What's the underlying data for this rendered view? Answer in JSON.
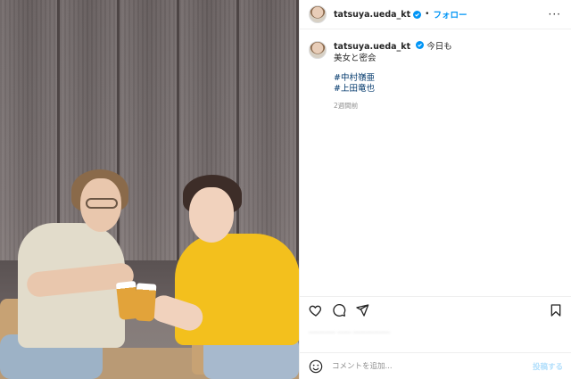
{
  "post": {
    "username": "tatsuya.ueda_kt",
    "follow_label": "フォロー",
    "caption_lines": [
      "今日も",
      "美女と密会"
    ],
    "hashtags": [
      "#中村嶺亜",
      "#上田竜也"
    ],
    "time_ago": "2週間前",
    "likes_text": "________ ____ ___________",
    "comment_placeholder": "コメントを追加...",
    "post_label": "投稿する"
  },
  "icons": {
    "more": "more-icon",
    "verified": "verified-badge-icon",
    "like": "heart-icon",
    "comment": "comment-icon",
    "share": "share-icon",
    "save": "bookmark-icon",
    "emoji": "emoji-icon"
  },
  "colors": {
    "accent": "#0095f6",
    "hashtag": "#00376b",
    "muted": "#8e8e8e"
  }
}
